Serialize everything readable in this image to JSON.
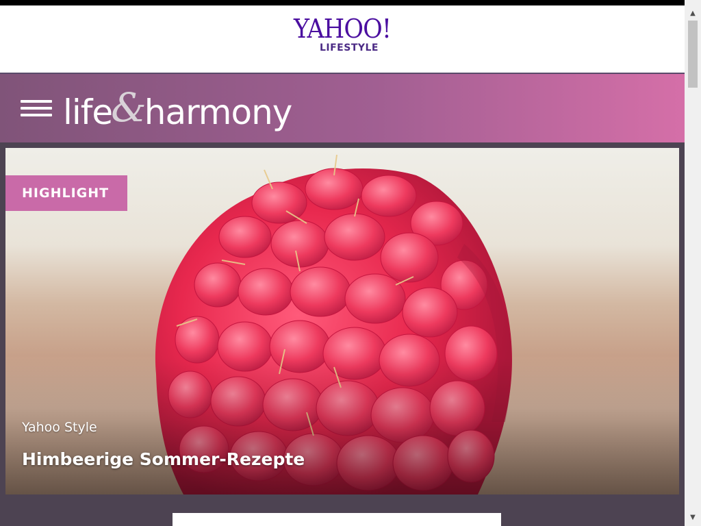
{
  "header": {
    "logo_main": "YAHOO!",
    "logo_sub": "LIFESTYLE"
  },
  "section": {
    "title_left": "life",
    "title_amp": "&",
    "title_right": "harmony",
    "menu_icon": "hamburger-menu-icon"
  },
  "hero": {
    "badge": "HIGHLIGHT",
    "source": "Yahoo Style",
    "title": "Himbeerige Sommer-Rezepte",
    "image": "raspberry-photo"
  },
  "colors": {
    "logo": "#4b0fa0",
    "section_bar_start": "#805479",
    "section_bar_end": "#d56fa8",
    "badge": "#c96aa8",
    "content_bg": "#4d4352"
  },
  "scrollbar": {
    "up_icon": "scroll-up-arrow-icon",
    "down_icon": "scroll-down-arrow-icon"
  }
}
